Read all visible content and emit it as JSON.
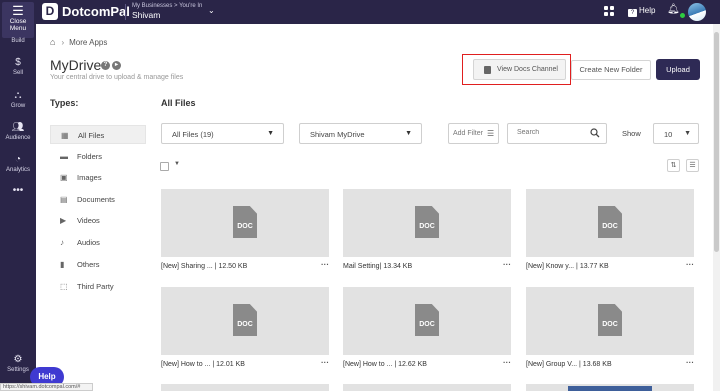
{
  "sidebar": {
    "menu_label": "Close Menu",
    "items": [
      {
        "label": "Build",
        "icon": "build-icon"
      },
      {
        "label": "Sell",
        "icon": "dollar-icon"
      },
      {
        "label": "Grow",
        "icon": "grow-icon"
      },
      {
        "label": "Audience",
        "icon": "audience-icon"
      },
      {
        "label": "Analytics",
        "icon": "analytics-icon"
      },
      {
        "label": "",
        "icon": "more-icon"
      },
      {
        "label": "Settings",
        "icon": "gear-icon"
      }
    ]
  },
  "header": {
    "logo_text": "DotcomPal",
    "biz_crumb": "My Businesses > You're In",
    "biz_name": "Shivam",
    "help_label": "Help"
  },
  "breadcrumb": {
    "current": "More Apps"
  },
  "page": {
    "title": "MyDrive",
    "subtitle": "Your central drive to upload & manage files"
  },
  "actions": {
    "docs_channel": "View Docs Channel",
    "new_folder": "Create New Folder",
    "upload": "Upload"
  },
  "types": {
    "heading": "Types:",
    "items": [
      {
        "label": "All Files",
        "icon": "grid-icon",
        "active": true
      },
      {
        "label": "Folders",
        "icon": "folder-icon"
      },
      {
        "label": "Images",
        "icon": "image-icon"
      },
      {
        "label": "Documents",
        "icon": "document-icon"
      },
      {
        "label": "Videos",
        "icon": "video-icon"
      },
      {
        "label": "Audios",
        "icon": "music-icon"
      },
      {
        "label": "Others",
        "icon": "file-icon"
      },
      {
        "label": "Third Party",
        "icon": "third-party-icon"
      }
    ]
  },
  "files": {
    "heading": "All Files",
    "filter_select": "All Files (19)",
    "drive_select": "Shivam MyDrive",
    "add_filter": "Add Filter",
    "search_placeholder": "Search",
    "show_label": "Show",
    "show_value": "10",
    "doc_label": "DOC",
    "cards": [
      {
        "caption": "[New] Sharing ... | 12.50 KB"
      },
      {
        "caption": "Mail Setting| 13.34 KB"
      },
      {
        "caption": "[New] Know y... | 13.77 KB"
      },
      {
        "caption": "[New] How to ... | 12.01 KB"
      },
      {
        "caption": "[New] How to ... | 12.62 KB"
      },
      {
        "caption": "[New] Group V... | 13.68 KB"
      }
    ]
  },
  "help_pill": "Help",
  "status_url": "https://shivam.dotcompal.com/#",
  "colors": {
    "sidebar_bg": "#2a2548",
    "upload_bg": "#2e2a55",
    "highlight": "#e01f1f",
    "help_pill": "#3f3ad1"
  }
}
